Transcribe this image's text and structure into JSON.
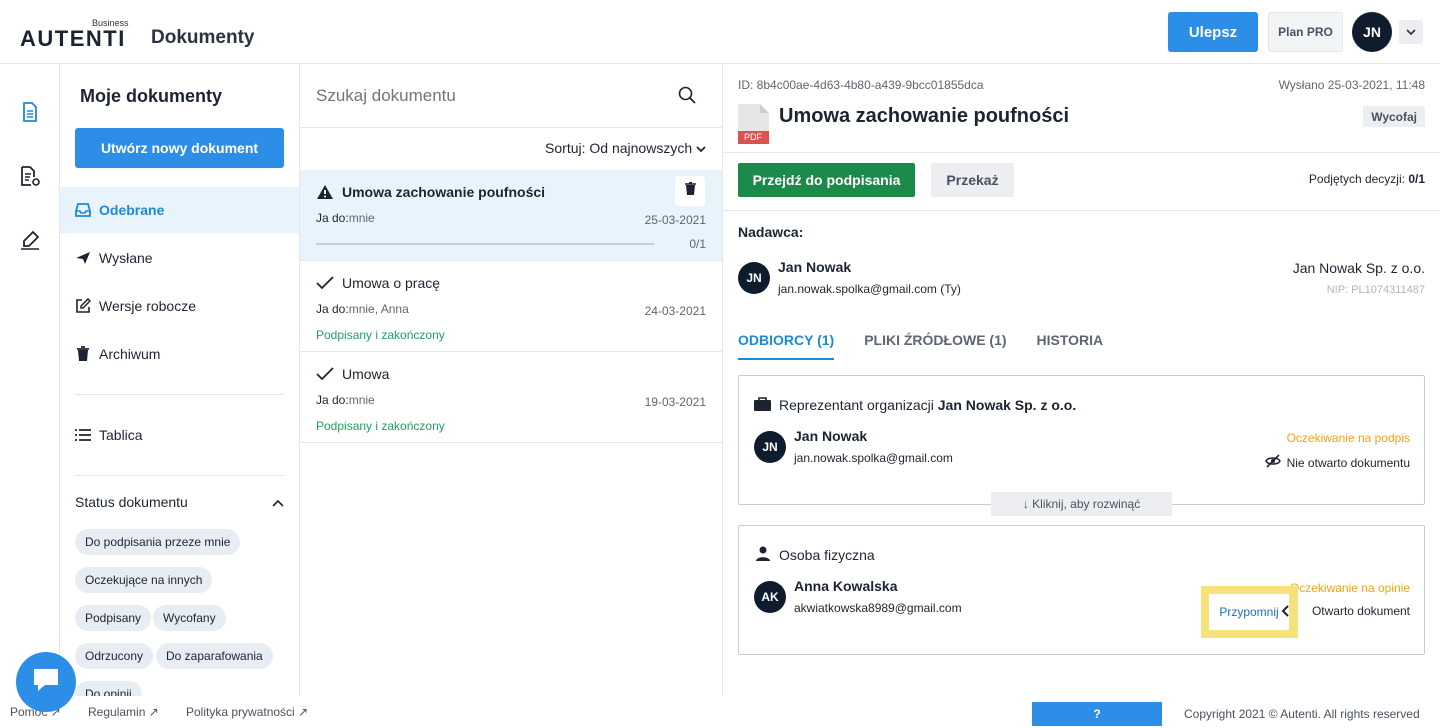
{
  "header": {
    "brand": "AUTENTI",
    "brand_sub": "Business",
    "app_title": "Dokumenty",
    "upgrade_label": "Ulepsz",
    "plan_label": "Plan PRO",
    "user_initials": "JN"
  },
  "sidebar": {
    "title": "Moje dokumenty",
    "new_doc_label": "Utwórz nowy dokument",
    "items": [
      {
        "label": "Odebrane",
        "icon": "inbox-icon",
        "active": true
      },
      {
        "label": "Wysłane",
        "icon": "send-icon",
        "active": false
      },
      {
        "label": "Wersje robocze",
        "icon": "edit-icon",
        "active": false
      },
      {
        "label": "Archiwum",
        "icon": "trash-icon",
        "active": false
      }
    ],
    "board_label": "Tablica",
    "status_title": "Status dokumentu",
    "status_chips": [
      "Do podpisania przeze mnie",
      "Oczekujące na innych",
      "Podpisany",
      "Wycofany",
      "Odrzucony",
      "Do zaparafowania",
      "Do opinii"
    ]
  },
  "list": {
    "search_placeholder": "Szukaj dokumentu",
    "sort_label": "Sortuj: Od najnowszych",
    "to_label": "Ja do:",
    "items": [
      {
        "title": "Umowa zachowanie poufności",
        "to": "mnie",
        "date": "25-03-2021",
        "progress": "0/1",
        "progress_fraction": 0,
        "status": "",
        "icon": "warning-icon"
      },
      {
        "title": "Umowa o pracę",
        "to": "mnie, Anna",
        "date": "24-03-2021",
        "progress": "",
        "status": "Podpisany i zakończony",
        "icon": "check-icon"
      },
      {
        "title": "Umowa",
        "to": "mnie",
        "date": "19-03-2021",
        "progress": "",
        "status": "Podpisany i zakończony",
        "icon": "check-icon"
      }
    ]
  },
  "detail": {
    "id": "ID: 8b4c00ae-4d63-4b80-a439-9bcc01855dca",
    "sent": "Wysłano 25-03-2021, 11:48",
    "title": "Umowa zachowanie poufności",
    "file_badge": "PDF",
    "revoke_label": "Wycofaj",
    "sign_label": "Przejdź do podpisania",
    "forward_label": "Przekaż",
    "decisions_label": "Podjętych decyzji: ",
    "decisions_value": "0/1",
    "sender_label": "Nadawca:",
    "sender": {
      "initials": "JN",
      "name": "Jan Nowak",
      "email": "jan.nowak.spolka@gmail.com (Ty)",
      "company": "Jan Nowak Sp. z o.o.",
      "nip": "NIP: PL1074311487"
    },
    "tabs": [
      "ODBIORCY (1)",
      "PLIKI ŹRÓDŁOWE (1)",
      "HISTORIA"
    ],
    "org_card": {
      "title_prefix": "Reprezentant organizacji ",
      "title_org": "Jan Nowak Sp. z o.o.",
      "initials": "JN",
      "name": "Jan Nowak",
      "email": "jan.nowak.spolka@gmail.com",
      "status": "Oczekiwanie na podpis",
      "doc_state": "Nie otwarto dokumentu",
      "expand_label": "↓ Kliknij, aby rozwinąć"
    },
    "person_card": {
      "title": "Osoba fizyczna",
      "initials": "AK",
      "name": "Anna Kowalska",
      "email": "akwiatkowska8989@gmail.com",
      "status": "Oczekiwanie na opinie",
      "remind_label": "Przypomnij",
      "doc_state": "Otwarto dokument"
    }
  },
  "footer": {
    "links": [
      "Pomoc",
      "Regulamin",
      "Polityka prywatności"
    ],
    "help_label": "?",
    "copyright": "Copyright 2021 © Autenti. All rights reserved"
  },
  "colors": {
    "accent": "#2d8ee8",
    "success": "#1b8a4a",
    "warning": "#f2a312",
    "highlight": "#f5e27a"
  }
}
